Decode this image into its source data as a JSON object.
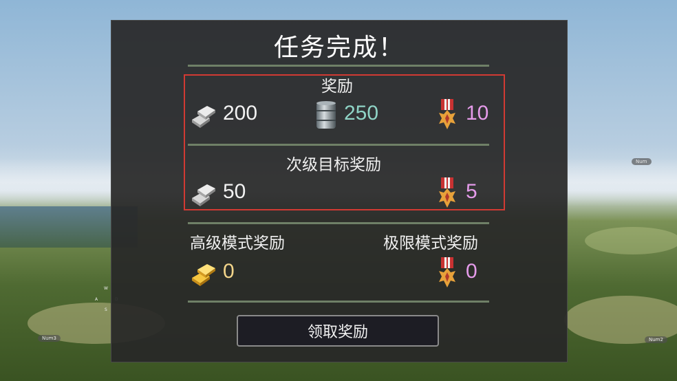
{
  "dialog": {
    "title": "任务完成！",
    "rewards": {
      "label": "奖励",
      "silver": "200",
      "fuel": "250",
      "medal": "10"
    },
    "secondary": {
      "label": "次级目标奖励",
      "silver": "50",
      "medal": "5"
    },
    "advanced": {
      "label": "高级模式奖励",
      "gold": "0"
    },
    "extreme": {
      "label": "极限模式奖励",
      "medal": "0"
    },
    "claim_button": "领取奖励"
  },
  "hud": {
    "right_tag": "Num",
    "left_tag": "Num3",
    "right_bottom_tag": "Num2",
    "compass": [
      "W",
      "A",
      "D",
      "S"
    ]
  },
  "colors": {
    "highlight": "#d23a33",
    "fuel_value": "#8fd4c6",
    "medal_value": "#e59bea",
    "gold_value": "#f3d58a"
  },
  "icons": [
    "silver-bars-icon",
    "fuel-barrel-icon",
    "medal-icon",
    "gold-bars-icon"
  ]
}
